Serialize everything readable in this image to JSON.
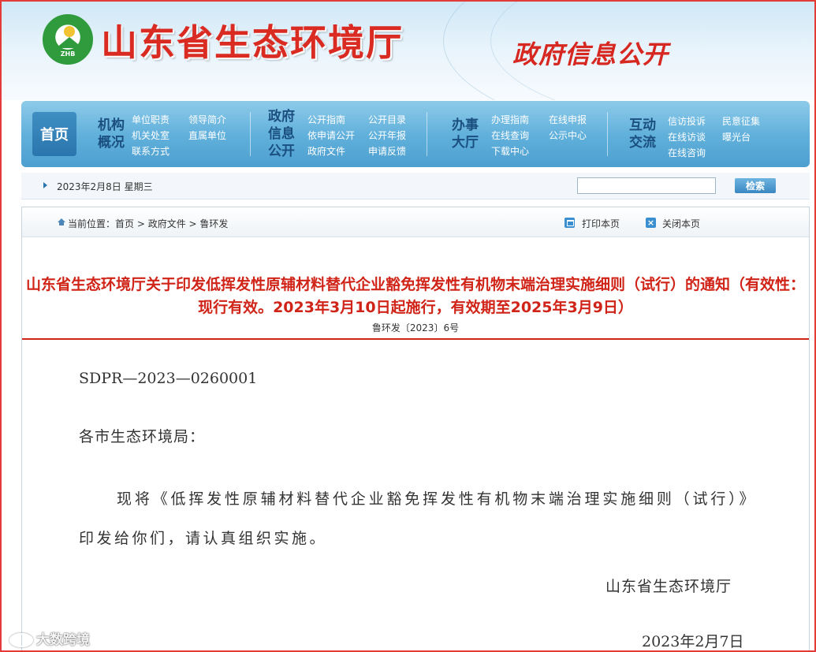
{
  "header": {
    "logo_text": "ZHB",
    "site_title": "山东省生态环境厅",
    "section_title": "政府信息公开"
  },
  "nav": {
    "home": "首页",
    "groups": [
      {
        "title_lines": [
          "机构",
          "概况"
        ],
        "links": [
          "单位职责",
          "领导简介",
          "机关处室",
          "直属单位",
          "联系方式"
        ]
      },
      {
        "title_lines": [
          "政府",
          "信息",
          "公开"
        ],
        "links": [
          "公开指南",
          "公开目录",
          "依申请公开",
          "公开年报",
          "政府文件",
          "申请反馈"
        ]
      },
      {
        "title_lines": [
          "办事",
          "大厅"
        ],
        "links": [
          "办理指南",
          "在线申报",
          "在线查询",
          "公示中心",
          "下载中心"
        ]
      },
      {
        "title_lines": [
          "互动",
          "交流"
        ],
        "links": [
          "信访投诉",
          "民意征集",
          "在线访谈",
          "曝光台",
          "在线咨询"
        ]
      }
    ]
  },
  "toolbar": {
    "date": "2023年2月8日 星期三",
    "search_value": "",
    "search_button": "检索"
  },
  "breadcrumb": {
    "prefix": "当前位置：",
    "items": [
      "首页",
      "政府文件",
      "鲁环发"
    ],
    "separator": " > "
  },
  "actions": {
    "print": "打印本页",
    "close": "关闭本页"
  },
  "document": {
    "title": "山东省生态环境厅关于印发低挥发性原辅材料替代企业豁免挥发性有机物末端治理实施细则（试行）的通知（有效性：现行有效。2023年3月10日起施行，有效期至2025年3月9日）",
    "number": "鲁环发〔2023〕6号",
    "code": "SDPR—2023—0260001",
    "salutation": "各市生态环境局：",
    "paragraph": "现将《低挥发性原辅材料替代企业豁免挥发性有机物末端治理实施细则（试行）》印发给你们，请认真组织实施。",
    "signer": "山东省生态环境厅",
    "date": "2023年2月7日"
  },
  "watermark": "大数跨境",
  "colors": {
    "frame_border": "#e53a3a",
    "title_red": "#d02418",
    "nav_blue": "#62b1dc"
  }
}
